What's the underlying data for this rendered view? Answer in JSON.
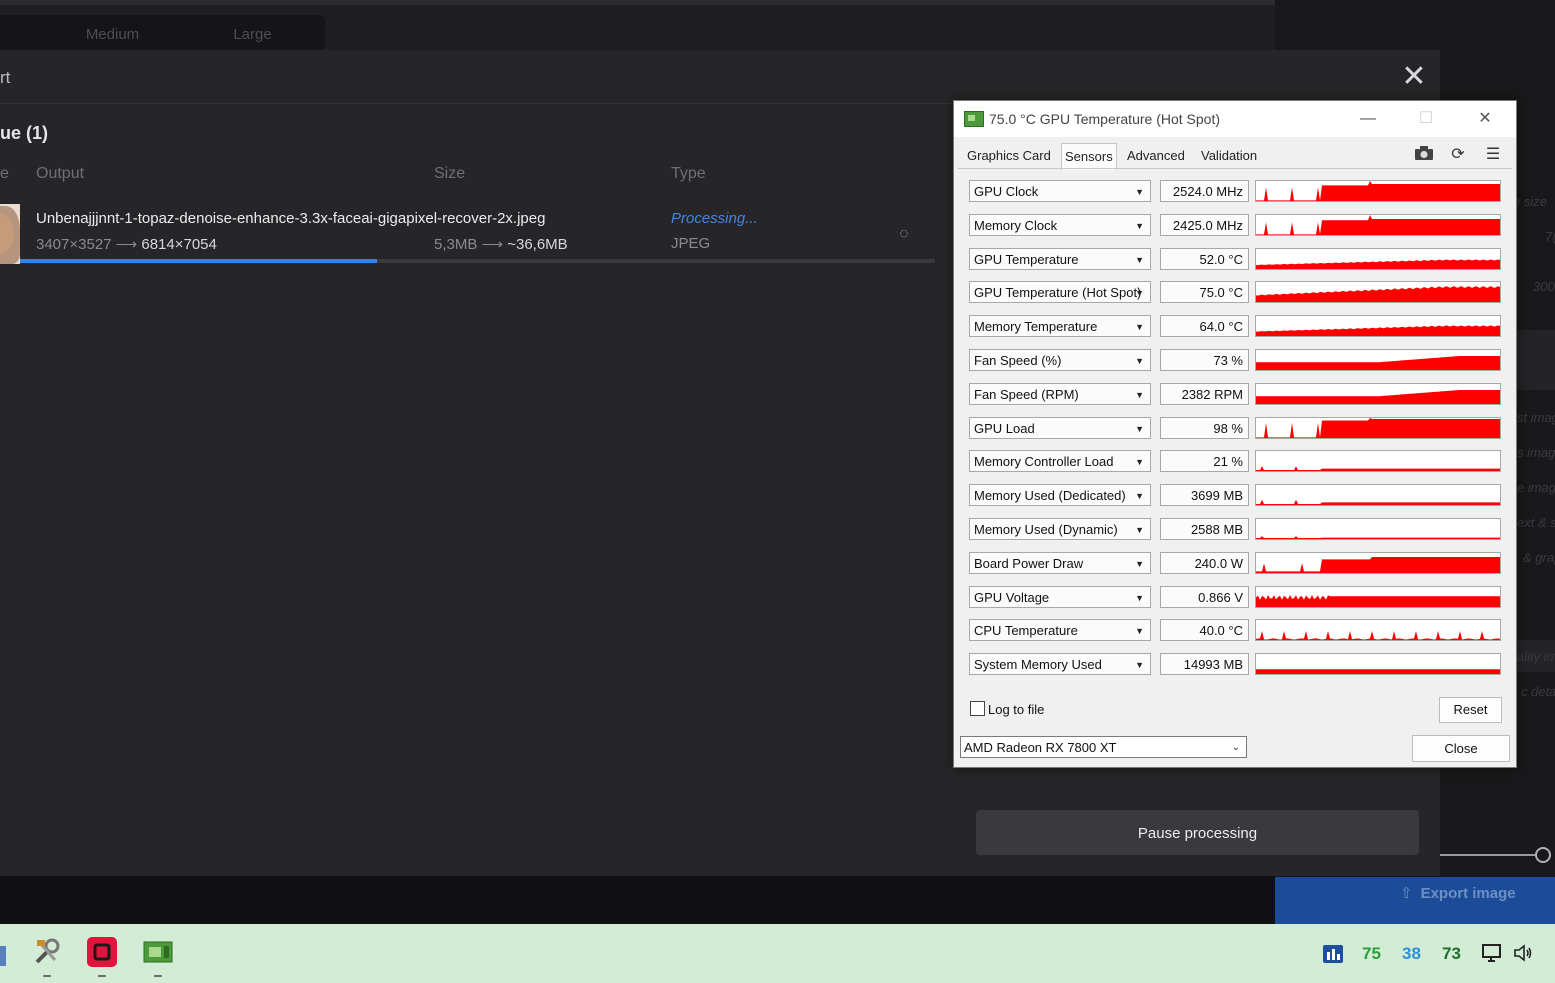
{
  "background_app": {
    "size_options": [
      "Medium",
      "Large"
    ],
    "dialog_title_fragment": "rt",
    "queue_title": "ue (1)",
    "columns": {
      "first": "e",
      "output": "Output",
      "size": "Size",
      "type": "Type"
    },
    "item": {
      "filename": "Unbenajjjnnt-1-topaz-denoise-enhance-3.3x-faceai-gigapixel-recover-2x.jpeg",
      "input_dims": "3407×3527",
      "output_dims": "6814×7054",
      "input_size": "5,3MB",
      "output_size": "~36,6MB",
      "status": "Processing...",
      "type": "JPEG",
      "progress_percent": 39
    },
    "arrow": "⟶",
    "pause_label": "Pause processing",
    "export_label": "Export image",
    "right_panel_fragments": [
      "e size",
      "7(",
      "300",
      "st imag",
      "s image",
      "e image",
      "ext & sh",
      "& grap",
      "ality im",
      "c deta"
    ]
  },
  "gpuz": {
    "title": "75.0 °C GPU Temperature (Hot Spot)",
    "tabs": [
      "Graphics Card",
      "Sensors",
      "Advanced",
      "Validation"
    ],
    "active_tab": "Sensors",
    "log_label": "Log to file",
    "reset_label": "Reset",
    "gpu_name": "AMD Radeon RX 7800 XT",
    "close_label": "Close",
    "graph_color": "#ff0000",
    "sensors": [
      {
        "name": "GPU Clock",
        "value": "2524.0 MHz",
        "level": 0.85,
        "profile": "stepped"
      },
      {
        "name": "Memory Clock",
        "value": "2425.0 MHz",
        "level": 0.8,
        "profile": "stepped"
      },
      {
        "name": "GPU Temperature",
        "value": "52.0 °C",
        "level": 0.45,
        "profile": "ramp"
      },
      {
        "name": "GPU Temperature (Hot Spot)",
        "value": "75.0 °C",
        "level": 0.75,
        "profile": "ramp"
      },
      {
        "name": "Memory Temperature",
        "value": "64.0 °C",
        "level": 0.5,
        "profile": "ramp"
      },
      {
        "name": "Fan Speed (%)",
        "value": "73 %",
        "level": 0.7,
        "profile": "fan"
      },
      {
        "name": "Fan Speed (RPM)",
        "value": "2382 RPM",
        "level": 0.7,
        "profile": "fan"
      },
      {
        "name": "GPU Load",
        "value": "98 %",
        "level": 0.95,
        "profile": "stepped"
      },
      {
        "name": "Memory Controller Load",
        "value": "21 %",
        "level": 0.2,
        "profile": "low"
      },
      {
        "name": "Memory Used (Dedicated)",
        "value": "3699 MB",
        "level": 0.22,
        "profile": "low"
      },
      {
        "name": "Memory Used (Dynamic)",
        "value": "2588 MB",
        "level": 0.12,
        "profile": "low"
      },
      {
        "name": "Board Power Draw",
        "value": "240.0 W",
        "level": 0.8,
        "profile": "power"
      },
      {
        "name": "GPU Voltage",
        "value": "0.866 V",
        "level": 0.6,
        "profile": "voltage"
      },
      {
        "name": "CPU Temperature",
        "value": "40.0 °C",
        "level": 0.15,
        "profile": "spiky"
      },
      {
        "name": "System Memory Used",
        "value": "14993 MB",
        "level": 0.3,
        "profile": "flat"
      }
    ]
  },
  "taskbar": {
    "apps": [
      "tools-app-icon",
      "red-square-app-icon",
      "gpuz-app-icon"
    ],
    "tray_values": [
      {
        "value": "75",
        "color": "#2e9e3a"
      },
      {
        "value": "38",
        "color": "#2f8fd0"
      },
      {
        "value": "73",
        "color": "#1f6e2a"
      }
    ]
  }
}
